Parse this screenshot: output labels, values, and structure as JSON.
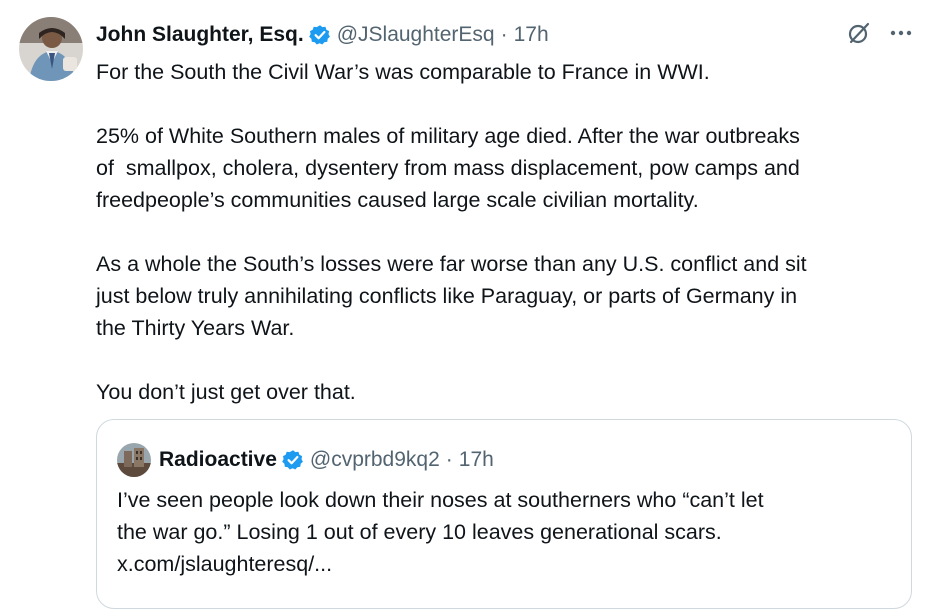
{
  "tweet": {
    "display_name": "John Slaughter, Esq.",
    "handle": "@JSlaughterEsq",
    "separator": "·",
    "time": "17h",
    "paragraphs": [
      "For the South the Civil War’s was comparable to France in WWI.",
      "25% of White Southern males of military age died. After the war outbreaks\nof  smallpox, cholera, dysentery from mass displacement, pow camps and\nfreedpeople’s communities caused large scale civilian mortality.",
      "As a whole the South’s losses were far worse than any U.S. conflict and sit\njust below truly annihilating conflicts like Paraguay, or parts of Germany in\nthe Thirty Years War.",
      "You don’t just get over that."
    ]
  },
  "quoted_tweet": {
    "display_name": "Radioactive",
    "handle": "@cvprbd9kq2",
    "separator": "·",
    "time": "17h",
    "lines": [
      "I’ve seen people look down their noses at southerners who “can’t let",
      "the war go.” Losing 1 out of every 10 leaves generational scars.",
      "x.com/jslaughteresq/..."
    ]
  },
  "icons": {
    "verified": "verified-badge-icon",
    "grok": "grok-icon",
    "more": "more-options-icon"
  },
  "colors": {
    "text_primary": "#0f1419",
    "text_secondary": "#536471",
    "verified_blue": "#1d9bf0",
    "border": "#cfd9de"
  }
}
